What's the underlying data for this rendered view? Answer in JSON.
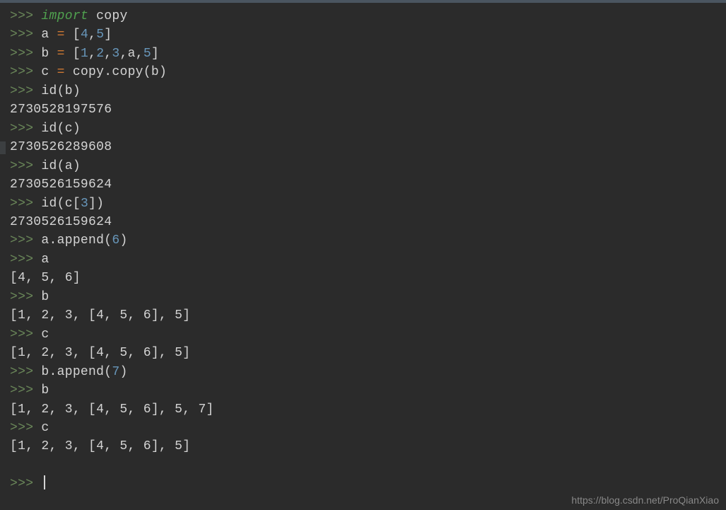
{
  "prompt": ">>>",
  "space": " ",
  "lines": {
    "l1": {
      "kw": "import",
      "rest": " copy"
    },
    "l2": {
      "var": "a ",
      "eq": "=",
      "sp": " ",
      "b1": "[",
      "n1": "4",
      "c1": ",",
      "n2": "5",
      "b2": "]"
    },
    "l3": {
      "var": "b ",
      "eq": "=",
      "sp": " ",
      "b1": "[",
      "n1": "1",
      "c1": ",",
      "n2": "2",
      "c2": ",",
      "n3": "3",
      "c3": ",a,",
      "n4": "5",
      "b2": "]"
    },
    "l4": {
      "var": "c ",
      "eq": "=",
      "rest": " copy.copy(b)"
    },
    "l5": {
      "txt": "id(b)"
    },
    "l6": {
      "out": "2730528197576"
    },
    "l7": {
      "txt": "id(c)"
    },
    "l8": {
      "out": "2730526289608"
    },
    "l9": {
      "txt": "id(a)"
    },
    "l10": {
      "out": "2730526159624"
    },
    "l11": {
      "p1": "id(c[",
      "n": "3",
      "p2": "])"
    },
    "l12": {
      "out": "2730526159624"
    },
    "l13": {
      "p1": "a.append(",
      "n": "6",
      "p2": ")"
    },
    "l14": {
      "txt": "a"
    },
    "l15": {
      "out": "[4, 5, 6]"
    },
    "l16": {
      "txt": "b"
    },
    "l17": {
      "out": "[1, 2, 3, [4, 5, 6], 5]"
    },
    "l18": {
      "txt": "c"
    },
    "l19": {
      "out": "[1, 2, 3, [4, 5, 6], 5]"
    },
    "l20": {
      "p1": "b.append(",
      "n": "7",
      "p2": ")"
    },
    "l21": {
      "txt": "b"
    },
    "l22": {
      "out": "[1, 2, 3, [4, 5, 6], 5, 7]"
    },
    "l23": {
      "txt": "c"
    },
    "l24": {
      "out": "[1, 2, 3, [4, 5, 6], 5]"
    }
  },
  "watermark": "https://blog.csdn.net/ProQianXiao"
}
